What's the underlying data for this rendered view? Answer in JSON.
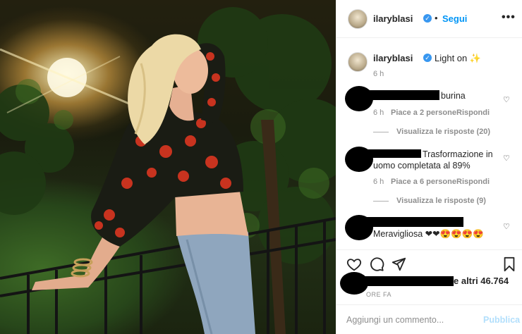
{
  "post": {
    "username": "ilaryblasi",
    "follow_label": "Segui",
    "more_label": "•••",
    "separator": "•"
  },
  "caption": {
    "username": "ilaryblasi",
    "text": "Light on ✨",
    "time": "6 h"
  },
  "comments": [
    {
      "text": "burina",
      "time": "6 h",
      "likes": "Piace a 2 persone",
      "reply": "Rispondi",
      "view_replies": "Visualizza le risposte (20)"
    },
    {
      "text_line1": "Trasformazione in",
      "text_line2": "uomo completata al 89%",
      "time": "6 h",
      "likes": "Piace a 6 persone",
      "reply": "Rispondi",
      "view_replies": "Visualizza le risposte (9)"
    },
    {
      "text": "Meravigliosa ❤❤😍😍😍😍"
    }
  ],
  "footer": {
    "likes_suffix": "e altri 46.764",
    "time_ago": "ORE FA",
    "add_comment_placeholder": "Aggiungi un commento...",
    "publish_label": "Pubblica"
  },
  "colors": {
    "accent": "#0095f6",
    "verified": "#3897f0",
    "muted": "#8e8e8e",
    "publish_disabled": "#b2dffc"
  },
  "icons": [
    "heart-icon",
    "comment-icon",
    "share-icon",
    "bookmark-icon",
    "verified-icon",
    "more-icon"
  ]
}
